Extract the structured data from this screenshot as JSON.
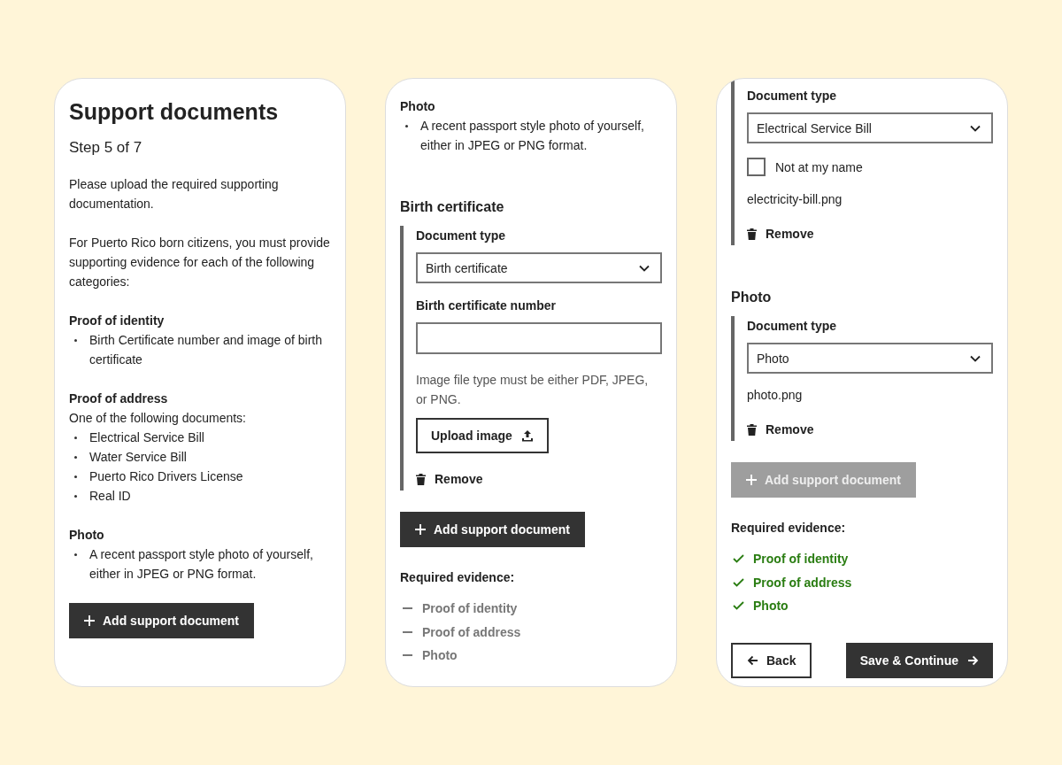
{
  "panels": [
    {
      "blocks": [
        {
          "kind": "title",
          "text": "Support documents"
        },
        {
          "kind": "step",
          "text": "Step 5 of 7"
        },
        {
          "kind": "paragraph",
          "text": "Please upload the required supporting documentation."
        },
        {
          "kind": "paragraph",
          "text": "For Puerto Rico born citizens, you must provide supporting evidence for each of the following categories:"
        },
        {
          "kind": "section",
          "title": "Proof of identity",
          "bullets": [
            "Birth Certificate number and image of birth certificate"
          ]
        },
        {
          "kind": "section",
          "title": "Proof of address",
          "intro": "One of the following documents:",
          "bullets": [
            "Electrical Service Bill",
            "Water Service Bill",
            "Puerto Rico Drivers License",
            "Real ID"
          ]
        },
        {
          "kind": "section",
          "title": "Photo",
          "bullets": [
            "A recent passport style photo of yourself, either in JPEG or PNG format."
          ]
        },
        {
          "kind": "button",
          "label": "Add support document",
          "disabled": false
        }
      ]
    },
    {
      "blocks": [
        {
          "kind": "section",
          "title": "Photo",
          "bullets": [
            "A recent passport style photo of yourself, either in JPEG or PNG format."
          ]
        },
        {
          "kind": "heading",
          "text": "Birth certificate"
        },
        {
          "kind": "group",
          "remove": "Remove",
          "fields": [
            {
              "kind": "select",
              "label": "Document type",
              "value": "Birth certificate"
            },
            {
              "kind": "input",
              "label": "Birth certificate number"
            },
            {
              "kind": "hint",
              "text": "Image file type must be either PDF, JPEG, or PNG."
            },
            {
              "kind": "upload",
              "label": "Upload image"
            }
          ]
        },
        {
          "kind": "button",
          "label": "Add support document",
          "disabled": false
        },
        {
          "kind": "evidence",
          "title": "Required evidence:",
          "items": [
            {
              "label": "Proof of identity",
              "done": false
            },
            {
              "label": "Proof of address",
              "done": false
            },
            {
              "label": "Photo",
              "done": false
            }
          ]
        }
      ]
    },
    {
      "blocks": [
        {
          "kind": "group",
          "remove": "Remove",
          "fields": [
            {
              "kind": "select",
              "label": "Document type",
              "value": "Electrical Service Bill"
            },
            {
              "kind": "checkbox",
              "label": "Not at my name",
              "checked": false
            },
            {
              "kind": "file",
              "name": "electricity-bill.png"
            }
          ]
        },
        {
          "kind": "heading",
          "text": "Photo"
        },
        {
          "kind": "group",
          "remove": "Remove",
          "fields": [
            {
              "kind": "select",
              "label": "Document type",
              "value": "Photo"
            },
            {
              "kind": "file",
              "name": "photo.png"
            }
          ]
        },
        {
          "kind": "button",
          "label": "Add support document",
          "disabled": true
        },
        {
          "kind": "evidence",
          "title": "Required evidence:",
          "items": [
            {
              "label": "Proof of identity",
              "done": true
            },
            {
              "label": "Proof of address",
              "done": true
            },
            {
              "label": "Photo",
              "done": true
            }
          ]
        },
        {
          "kind": "nav",
          "back": "Back",
          "next": "Save & Continue"
        }
      ]
    }
  ]
}
